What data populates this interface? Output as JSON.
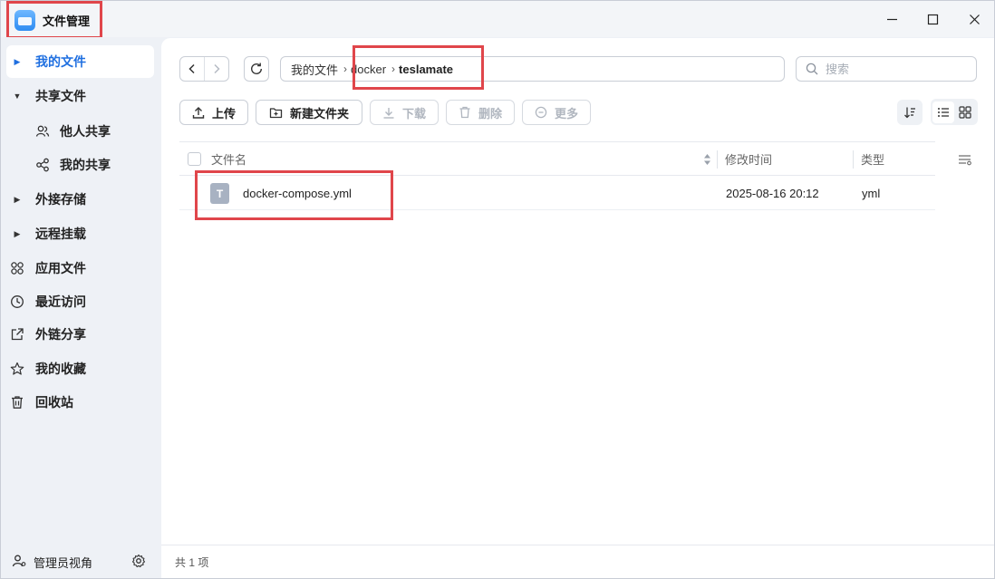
{
  "app": {
    "title": "文件管理"
  },
  "window_controls": {
    "minimize": "—",
    "maximize": "☐",
    "close": "✕"
  },
  "sidebar": {
    "items": [
      {
        "label": "我的文件",
        "icon": "caret-right-icon",
        "active": true
      },
      {
        "label": "共享文件",
        "icon": "caret-down-icon"
      },
      {
        "label": "他人共享",
        "icon": "people-icon"
      },
      {
        "label": "我的共享",
        "icon": "share-nodes-icon"
      },
      {
        "label": "外接存储",
        "icon": "caret-right-icon"
      },
      {
        "label": "远程挂载",
        "icon": "caret-right-icon"
      },
      {
        "label": "应用文件",
        "icon": "apps-icon"
      },
      {
        "label": "最近访问",
        "icon": "clock-icon"
      },
      {
        "label": "外链分享",
        "icon": "external-link-icon"
      },
      {
        "label": "我的收藏",
        "icon": "star-icon"
      },
      {
        "label": "回收站",
        "icon": "trash-icon"
      }
    ],
    "footer": {
      "label": "管理员视角",
      "icon": "admin-user-icon",
      "settings_icon": "gear-icon"
    }
  },
  "breadcrumb": {
    "items": [
      "我的文件",
      "docker",
      "teslamate"
    ],
    "separator": "›"
  },
  "search": {
    "placeholder": "搜索",
    "value": ""
  },
  "toolbar": {
    "upload": "上传",
    "new_folder": "新建文件夹",
    "download": "下载",
    "delete": "删除",
    "more": "更多"
  },
  "table": {
    "columns": {
      "name": "文件名",
      "modified": "修改时间",
      "type": "类型"
    },
    "rows": [
      {
        "icon_letter": "T",
        "name": "docker-compose.yml",
        "modified": "2025-08-16 20:12",
        "type": "yml"
      }
    ]
  },
  "status": {
    "count_text": "共 1 项"
  },
  "colors": {
    "accent": "#1f6fe0",
    "highlight": "#e0464b"
  }
}
